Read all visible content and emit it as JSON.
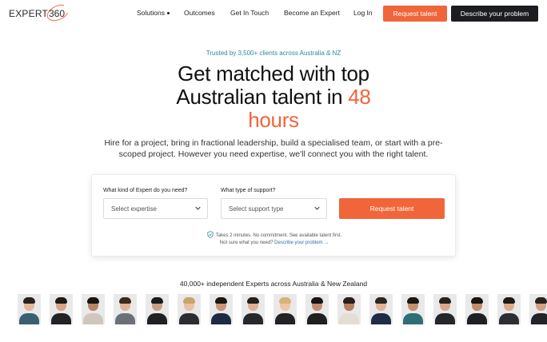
{
  "brand": {
    "logo_text": "EXPERT",
    "logo_num": "360",
    "accent": "#f1653a",
    "dark": "#1c1d21",
    "teal": "#2b8a9b"
  },
  "nav": {
    "solutions": "Solutions",
    "outcomes": "Outcomes",
    "get_in_touch": "Get In Touch",
    "become_expert": "Become an Expert",
    "log_in": "Log In",
    "request_talent": "Request talent",
    "describe_problem": "Describe your problem"
  },
  "hero": {
    "trusted": "Trusted by 3,500+ clients across Australia & NZ",
    "headline_line1": "Get matched with top",
    "headline_line2": "Australian talent in ",
    "headline_accent1": "48",
    "headline_accent2": "hours",
    "subtitle": "Hire for a project, bring in fractional leadership, build a specialised team, or start with a pre-scoped project. However you need expertise, we'll connect you with the right talent."
  },
  "form": {
    "expert_label": "What kind of Expert do you need?",
    "expert_placeholder": "Select expertise",
    "support_label": "What type of support?",
    "support_placeholder": "Select support type",
    "submit": "Request talent",
    "note": "Takes 2 minutes. No commitment. See available talent first.",
    "not_sure": "Not sure what you need? ",
    "describe_link": "Describe your problem →"
  },
  "experts": {
    "title": "40,000+ independent Experts across Australia & New Zealand",
    "avatars": [
      {
        "hair": "#2b211c",
        "skin": "#e3b89a",
        "top": "#3a5f6e"
      },
      {
        "hair": "#1e1a18",
        "skin": "#d8a486",
        "top": "#222326"
      },
      {
        "hair": "#1a1512",
        "skin": "#b98464",
        "top": "#cfc7bd"
      },
      {
        "hair": "#3b2a20",
        "skin": "#e2b497",
        "top": "#6b7078"
      },
      {
        "hair": "#1c1a19",
        "skin": "#caa084",
        "top": "#1f2023"
      },
      {
        "hair": "#c9a46a",
        "skin": "#eac1a4",
        "top": "#2b2d33"
      },
      {
        "hair": "#1a1614",
        "skin": "#c99477",
        "top": "#1d2a3f"
      },
      {
        "hair": "#24201d",
        "skin": "#dfb091",
        "top": "#27282b"
      },
      {
        "hair": "#d7b37a",
        "skin": "#edc6a8",
        "top": "#202226"
      },
      {
        "hair": "#171413",
        "skin": "#c58d70",
        "top": "#1e1f21"
      },
      {
        "hair": "#2a1e18",
        "skin": "#b57f60",
        "top": "#e4ddd3"
      },
      {
        "hair": "#2c2520",
        "skin": "#e0b395",
        "top": "#1f2d44"
      },
      {
        "hair": "#1b1715",
        "skin": "#c4906f",
        "top": "#2d6f74"
      },
      {
        "hair": "#28221e",
        "skin": "#d9a98b",
        "top": "#25262a"
      },
      {
        "hair": "#1a1513",
        "skin": "#c28b6c",
        "top": "#1f2024"
      },
      {
        "hair": "#1f1a17",
        "skin": "#dcab8c",
        "top": "#2c2e33"
      },
      {
        "hair": "#2a221d",
        "skin": "#d2a083",
        "top": "#222429"
      }
    ]
  }
}
